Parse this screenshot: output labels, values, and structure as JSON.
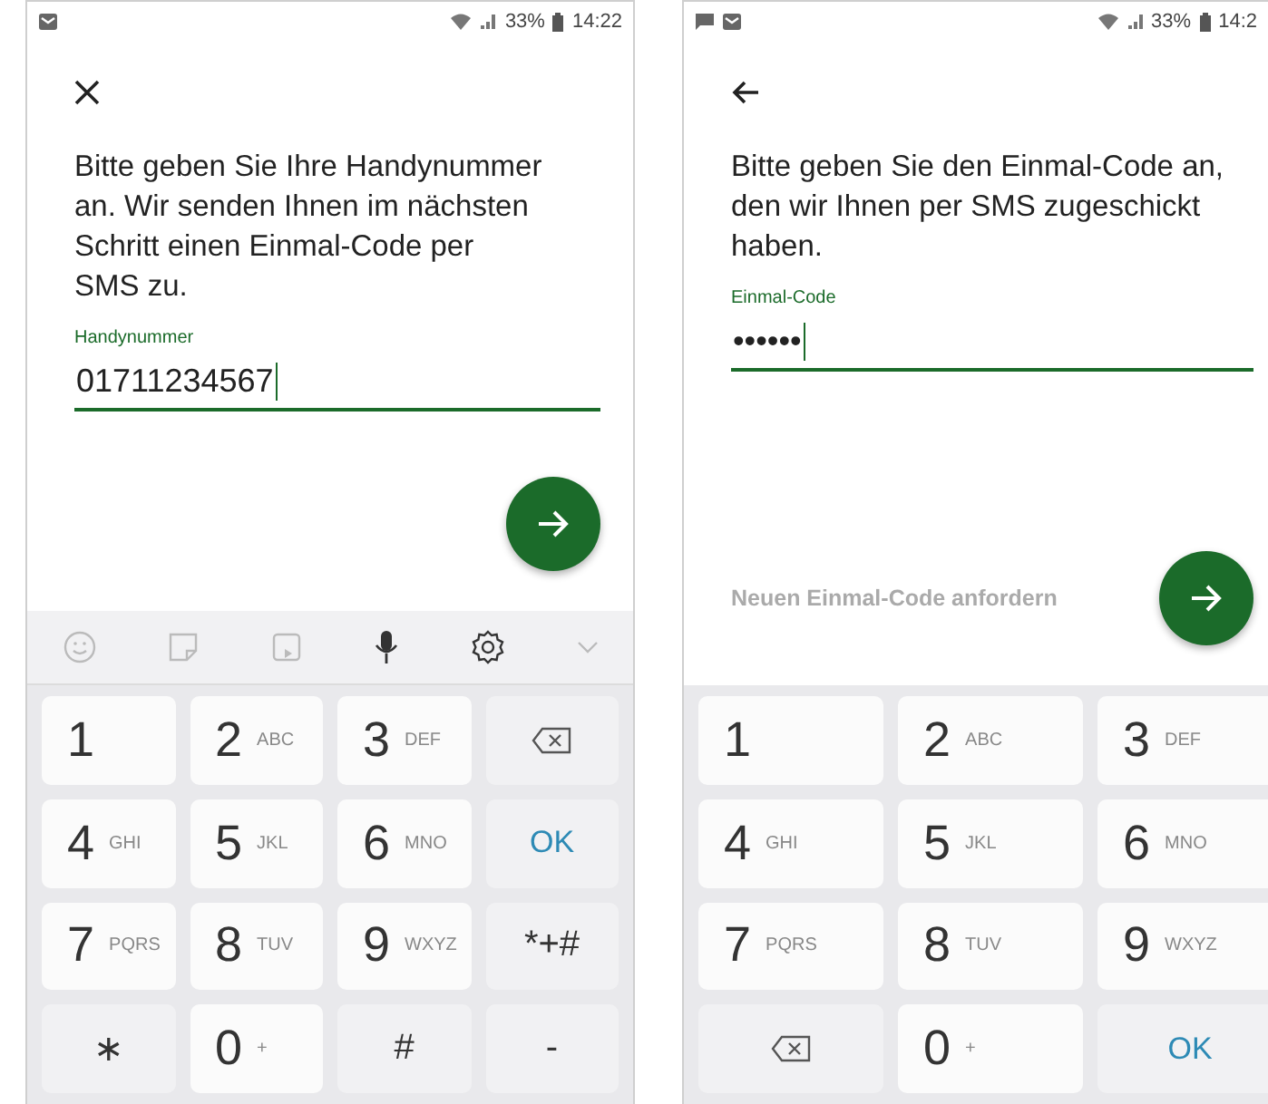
{
  "screens": [
    {
      "status_bar": {
        "notification_icons": [
          {
            "kind": "mail"
          }
        ],
        "battery": "33%",
        "time": "14:22"
      },
      "nav_icon": {
        "kind": "close"
      },
      "message": "Bitte geben Sie Ihre Handynummer an. Wir senden Ihnen im nächsten Schritt einen Einmal-Code per SMS zu.",
      "field": {
        "label": "Handynummer",
        "value": "01711234567"
      },
      "keyboard": {
        "toolbar": true,
        "keys": [
          {
            "kind": "digit",
            "main": "1"
          },
          {
            "kind": "digit",
            "main": "2",
            "sub": "ABC"
          },
          {
            "kind": "digit",
            "main": "3",
            "sub": "DEF"
          },
          {
            "kind": "backspace"
          },
          {
            "kind": "digit",
            "main": "4",
            "sub": "GHI"
          },
          {
            "kind": "digit",
            "main": "5",
            "sub": "JKL"
          },
          {
            "kind": "digit",
            "main": "6",
            "sub": "MNO"
          },
          {
            "kind": "ok",
            "main": "OK"
          },
          {
            "kind": "digit",
            "main": "7",
            "sub": "PQRS"
          },
          {
            "kind": "digit",
            "main": "8",
            "sub": "TUV"
          },
          {
            "kind": "digit",
            "main": "9",
            "sub": "WXYZ"
          },
          {
            "kind": "symbol",
            "main": "*+#"
          },
          {
            "kind": "symbol",
            "main": "∗"
          },
          {
            "kind": "digit",
            "main": "0",
            "sub": "+"
          },
          {
            "kind": "symbol",
            "main": "#"
          },
          {
            "kind": "symbol",
            "main": "-"
          }
        ]
      }
    },
    {
      "status_bar": {
        "notification_icons": [
          {
            "kind": "chat"
          },
          {
            "kind": "mail"
          }
        ],
        "battery": "33%",
        "time": "14:2"
      },
      "nav_icon": {
        "kind": "back"
      },
      "message": "Bitte geben Sie den Einmal-Code an, den wir Ihnen per SMS zugeschickt haben.",
      "field": {
        "label": "Einmal-Code",
        "value": "••••••"
      },
      "link": "Neuen Einmal-Code anfordern",
      "keyboard": {
        "keys": [
          {
            "kind": "digit",
            "main": "1"
          },
          {
            "kind": "digit",
            "main": "2",
            "sub": "ABC"
          },
          {
            "kind": "digit",
            "main": "3",
            "sub": "DEF"
          },
          {
            "kind": "digit",
            "main": "4",
            "sub": "GHI"
          },
          {
            "kind": "digit",
            "main": "5",
            "sub": "JKL"
          },
          {
            "kind": "digit",
            "main": "6",
            "sub": "MNO"
          },
          {
            "kind": "digit",
            "main": "7",
            "sub": "PQRS"
          },
          {
            "kind": "digit",
            "main": "8",
            "sub": "TUV"
          },
          {
            "kind": "digit",
            "main": "9",
            "sub": "WXYZ"
          },
          {
            "kind": "backspace"
          },
          {
            "kind": "digit",
            "main": "0",
            "sub": "+"
          },
          {
            "kind": "ok",
            "main": "OK"
          }
        ]
      }
    }
  ]
}
